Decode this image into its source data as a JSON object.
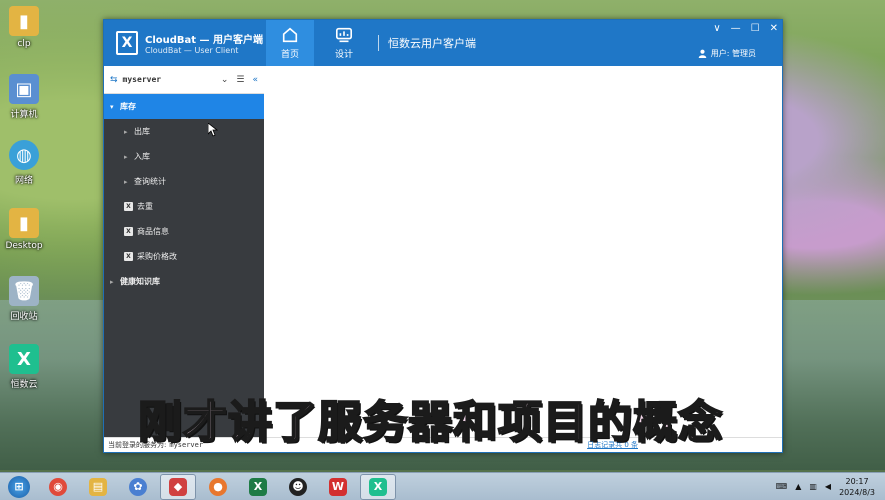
{
  "desktop": {
    "icons": [
      {
        "label": "clp",
        "icon": "folder-icon",
        "color": "#e3b443"
      },
      {
        "label": "计算机",
        "icon": "computer-icon",
        "color": "#5a8fd1"
      },
      {
        "label": "网络",
        "icon": "network-icon",
        "color": "#3aa0d8"
      },
      {
        "label": "Desktop",
        "icon": "folder-icon",
        "color": "#e3b443"
      },
      {
        "label": "回收站",
        "icon": "recycle-bin-icon",
        "color": "#9db3c6"
      },
      {
        "label": "恒数云",
        "icon": "hengshuyun-app-icon",
        "color": "#1fbf8f"
      }
    ]
  },
  "window": {
    "app_title": "CloudBat — 用户客户端",
    "app_subtitle": "CloudBat — User Client",
    "logo_glyph": "X",
    "nav": [
      {
        "label": "首页",
        "icon": "home-icon",
        "active": true
      },
      {
        "label": "设计",
        "icon": "design-icon",
        "active": false
      }
    ],
    "product_title": "恒数云用户客户端",
    "window_controls": [
      "∨",
      "—",
      "☐",
      "✕"
    ],
    "user_label": "用户: 管理员",
    "colors": {
      "titlebar": "#1f77c7",
      "active_nav": "#2f8ee0",
      "sidebar": "#383b3f",
      "menu_active": "#1f85e6"
    }
  },
  "sidebar": {
    "server_name": "myserver",
    "menu": [
      {
        "label": "库存",
        "level": 0,
        "type": "group",
        "expanded": true,
        "active": true
      },
      {
        "label": "出库",
        "level": 1,
        "type": "group"
      },
      {
        "label": "入库",
        "level": 1,
        "type": "group"
      },
      {
        "label": "查询统计",
        "level": 1,
        "type": "group"
      },
      {
        "label": "去重",
        "level": 1,
        "type": "sheet"
      },
      {
        "label": "商品信息",
        "level": 1,
        "type": "sheet"
      },
      {
        "label": "采购价格改",
        "level": 1,
        "type": "sheet"
      },
      {
        "label": "健康知识库",
        "level": 0,
        "type": "group"
      }
    ]
  },
  "statusbar": {
    "server_label": "当前登录的服务为:",
    "server_name": "myserver",
    "log_link": "日志记录共 0 条"
  },
  "overlay_subtitle": "刚才讲了服务器和项目的概念",
  "taskbar": {
    "apps": [
      {
        "name": "chrome-icon",
        "color": "#e04a3a",
        "glyph": "◉",
        "active": false
      },
      {
        "name": "file-explorer-icon",
        "color": "#e3b443",
        "glyph": "▤",
        "active": false
      },
      {
        "name": "network-app-icon",
        "color": "#4a7fd1",
        "glyph": "✿",
        "active": false
      },
      {
        "name": "app-icon",
        "color": "#d04040",
        "glyph": "◆",
        "active": true
      },
      {
        "name": "firefox-icon",
        "color": "#e8772e",
        "glyph": "●",
        "active": false
      },
      {
        "name": "excel-icon",
        "color": "#1e7b45",
        "glyph": "X",
        "active": false
      },
      {
        "name": "qq-icon",
        "color": "#222222",
        "glyph": "☻",
        "active": false
      },
      {
        "name": "wps-icon",
        "color": "#d33030",
        "glyph": "W",
        "active": false
      },
      {
        "name": "hengshuyun-icon",
        "color": "#1fbf8f",
        "glyph": "X",
        "active": true
      }
    ],
    "time": "20:17",
    "date": "2024/8/3"
  }
}
